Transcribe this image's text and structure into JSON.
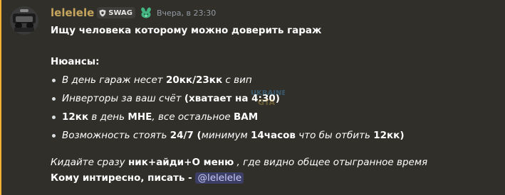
{
  "message": {
    "author": {
      "username": "lelelele",
      "guild_tag": "SWAG",
      "name_color": "#c6a65d",
      "avatar_icon": "avatar-image"
    },
    "timestamp": "Вчера, в 23:30",
    "accent_color": "#f0b232",
    "title": "Ищу человека которому можно доверить гараж",
    "nuances_heading": "Нюансы:",
    "nuances": [
      {
        "parts": [
          {
            "text": "В день гараж несет ",
            "style": "italic"
          },
          {
            "text": "20кк/23кк",
            "style": "bold"
          },
          {
            "text": " с вип",
            "style": "italic"
          }
        ]
      },
      {
        "parts": [
          {
            "text": "Инверторы за ваш счёт ",
            "style": "italic"
          },
          {
            "text": "(хватает на 4:30)",
            "style": "bold"
          }
        ]
      },
      {
        "parts": [
          {
            "text": "12кк",
            "style": "bold"
          },
          {
            "text": " в день ",
            "style": "italic"
          },
          {
            "text": "МНЕ",
            "style": "bold"
          },
          {
            "text": ", все остальное ",
            "style": "italic"
          },
          {
            "text": "ВАМ",
            "style": "bold"
          }
        ]
      },
      {
        "parts": [
          {
            "text": "Возможность стоять ",
            "style": "italic"
          },
          {
            "text": "24/7",
            "style": "bold"
          },
          {
            "text": " (",
            "style": "bold"
          },
          {
            "text": "минимум ",
            "style": "italic"
          },
          {
            "text": "14часов",
            "style": "bold"
          },
          {
            "text": " что бы отбить ",
            "style": "italic"
          },
          {
            "text": "12кк",
            "style": "bold"
          },
          {
            "text": ")",
            "style": "bold"
          }
        ]
      }
    ],
    "footer_line1": [
      {
        "text": "Кидайте сразу ",
        "style": "italic"
      },
      {
        "text": "ник+айди+О меню",
        "style": "bold"
      },
      {
        "text": " , где видно общее отыгранное время",
        "style": "italic"
      }
    ],
    "footer_line2_text": "Кому интиресно, писать - ",
    "mention": "@lelelele"
  },
  "icons": {
    "guild_tag_icon": "shield-icon",
    "badge_icon": "nitro-bunny-icon"
  }
}
